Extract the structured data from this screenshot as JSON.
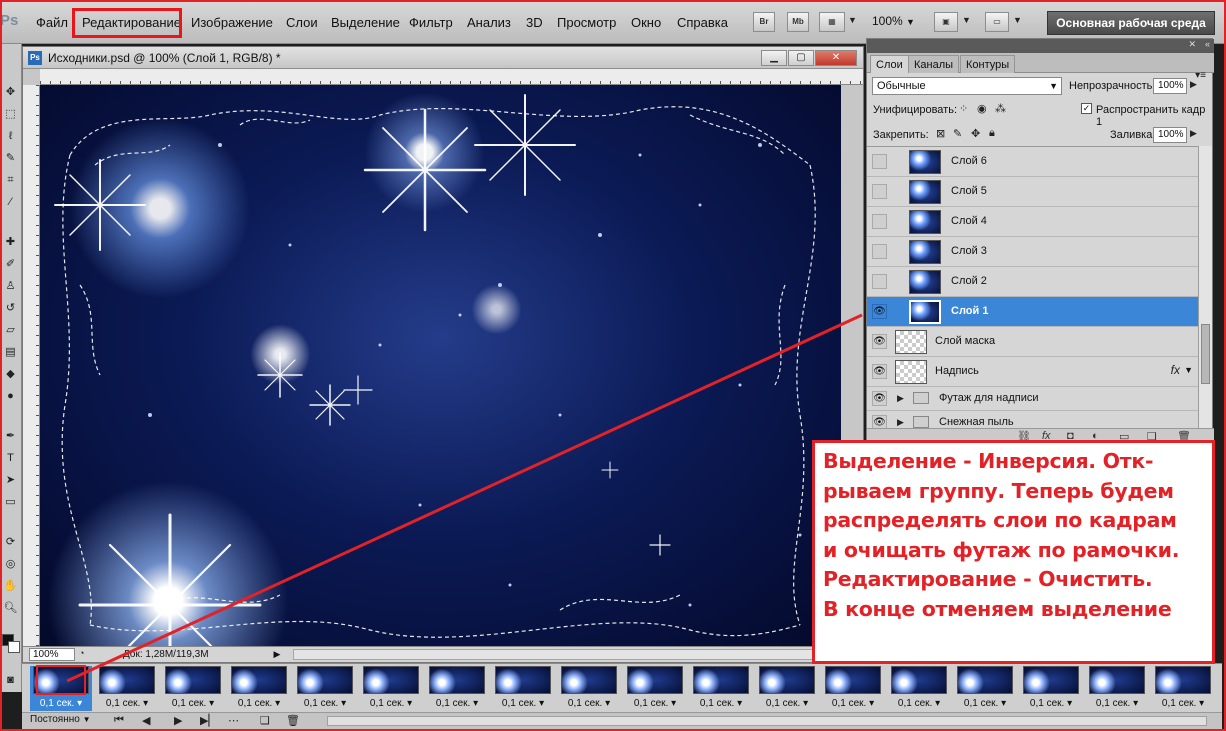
{
  "app": {
    "logo": "Ps"
  },
  "menu": {
    "items": [
      "Файл",
      "Редактирование",
      "Изображение",
      "Слои",
      "Выделение",
      "Фильтр",
      "Анализ",
      "3D",
      "Просмотр",
      "Окно",
      "Справка"
    ],
    "highlighted": "Редактирование",
    "bridge_label": "Br",
    "minibridge_label": "Mb",
    "zoom": "100%",
    "workspace": "Основная рабочая среда"
  },
  "document": {
    "title": "Исходники.psd @ 100% (Слой 1, RGB/8) *",
    "zoom_field": "100%",
    "doc_info": "Док: 1,28M/119,3M"
  },
  "layers_panel": {
    "tabs": [
      "Слои",
      "Каналы",
      "Контуры"
    ],
    "active_tab": "Слои",
    "blend_mode": "Обычные",
    "opacity_label": "Непрозрачность:",
    "opacity_value": "100%",
    "unify_label": "Унифицировать:",
    "propagate_label": "Распространить кадр 1",
    "lock_label": "Закрепить:",
    "fill_label": "Заливка:",
    "fill_value": "100%",
    "layers": [
      {
        "name": "Слой 6",
        "visible": false,
        "selected": false,
        "type": "image"
      },
      {
        "name": "Слой 5",
        "visible": false,
        "selected": false,
        "type": "image"
      },
      {
        "name": "Слой 4",
        "visible": false,
        "selected": false,
        "type": "image"
      },
      {
        "name": "Слой 3",
        "visible": false,
        "selected": false,
        "type": "image"
      },
      {
        "name": "Слой 2",
        "visible": false,
        "selected": false,
        "type": "image"
      },
      {
        "name": "Слой 1",
        "visible": true,
        "selected": true,
        "type": "image"
      },
      {
        "name": "Слой маска",
        "visible": true,
        "selected": false,
        "type": "transparent"
      },
      {
        "name": "Надпись",
        "visible": true,
        "selected": false,
        "type": "transparent-fx"
      },
      {
        "name": "Футаж для надписи",
        "visible": true,
        "selected": false,
        "type": "group"
      },
      {
        "name": "Снежная пыль",
        "visible": true,
        "selected": false,
        "type": "group"
      }
    ],
    "fx_label": "fx"
  },
  "timeline": {
    "frame_delay": "0,1 сек.",
    "frame_count": 18,
    "selected_frame": 1,
    "loop": "Постоянно"
  },
  "annotation": {
    "text": "Выделение - Инверсия. Отк-\nрываем группу. Теперь будем\nраспределять слои по кадрам\nи очищать футаж по рамочки.\nРедактирование - Очистить.\nВ конце отменяем выделение",
    "color": "#e32227"
  }
}
